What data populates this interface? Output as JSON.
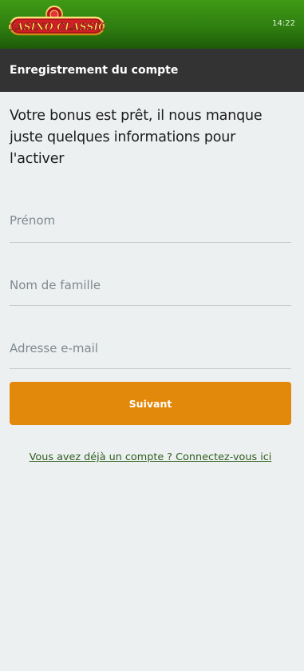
{
  "status": {
    "time": "14:22"
  },
  "brand": {
    "logo_text": "CASINO CLASSIC",
    "colors": {
      "header_green": "#2f7f10",
      "bar_dark": "#333333",
      "accent_orange": "#e2880a",
      "link_green": "#2e5d1e"
    }
  },
  "header": {
    "title": "Enregistrement du compte"
  },
  "form": {
    "headline": "Votre bonus est prêt, il nous manque juste quelques informations pour l'activer",
    "first_name": {
      "placeholder": "Prénom",
      "value": ""
    },
    "last_name": {
      "placeholder": "Nom de famille",
      "value": ""
    },
    "email": {
      "placeholder": "Adresse e-mail",
      "value": ""
    },
    "submit_label": "Suivant",
    "login_link": "Vous avez déjà un compte ? Connectez-vous ici"
  }
}
